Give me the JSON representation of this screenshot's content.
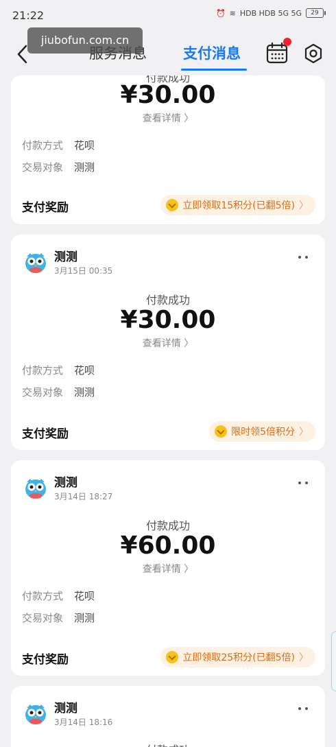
{
  "status_bar": {
    "time": "21:22",
    "network": "HDB HDB 5G 5G",
    "battery": "29"
  },
  "header": {
    "tab_service": "服务消息",
    "tab_pay": "支付消息"
  },
  "watermark": "jiubofun.com.cn",
  "cards": [
    {
      "merchant": "",
      "date": "",
      "status": "付款成功",
      "amount": "¥30.00",
      "detail": "查看详情 〉",
      "method_label": "付款方式",
      "method": "花呗",
      "party_label": "交易对象",
      "party": "测测",
      "reward_label": "支付奖励",
      "reward": "立即领取15积分(已翻5倍)"
    },
    {
      "merchant": "测测",
      "date": "3月15日 00:35",
      "status": "付款成功",
      "amount": "¥30.00",
      "detail": "查看详情 〉",
      "method_label": "付款方式",
      "method": "花呗",
      "party_label": "交易对象",
      "party": "测测",
      "reward_label": "支付奖励",
      "reward": "限时领5倍积分"
    },
    {
      "merchant": "测测",
      "date": "3月14日 18:27",
      "status": "付款成功",
      "amount": "¥60.00",
      "detail": "查看详情 〉",
      "method_label": "付款方式",
      "method": "花呗",
      "party_label": "交易对象",
      "party": "测测",
      "reward_label": "支付奖励",
      "reward": "立即领取25积分(已翻5倍)"
    },
    {
      "merchant": "测测",
      "date": "3月14日 18:16",
      "status": "付款成功"
    }
  ]
}
